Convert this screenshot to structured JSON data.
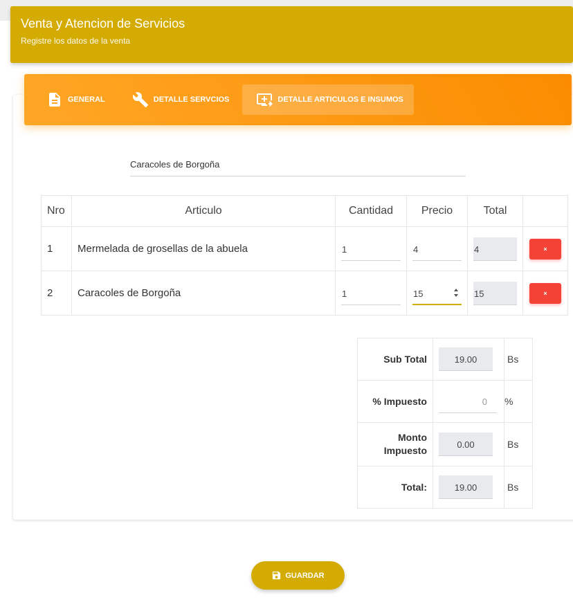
{
  "header": {
    "title": "Venta y Atencion de Servicios",
    "subtitle": "Registre los datos de la venta"
  },
  "tabs": [
    {
      "label": "GENERAL",
      "icon": "document-icon",
      "active": false
    },
    {
      "label": "DETALLE SERVCIOS",
      "icon": "wrench-icon",
      "active": false
    },
    {
      "label": "DETALLE ARTICULOS E INSUMOS",
      "icon": "monitor-add-icon",
      "active": true
    }
  ],
  "product_select": {
    "value": "Caracoles de Borgoña"
  },
  "items_table": {
    "headers": [
      "Nro",
      "Articulo",
      "Cantidad",
      "Precio",
      "Total"
    ],
    "rows": [
      {
        "nro": "1",
        "articulo": "Mermelada de grosellas de la abuela",
        "cantidad": "1",
        "precio": "4",
        "total": "4",
        "delete": "×"
      },
      {
        "nro": "2",
        "articulo": "Caracoles de Borgoña",
        "cantidad": "1",
        "precio": "15",
        "total": "15",
        "delete": "×"
      }
    ]
  },
  "totals": {
    "subtotal": {
      "label": "Sub Total",
      "value": "19.00",
      "unit": "Bs"
    },
    "impuesto": {
      "label": "% Impuesto",
      "value": "0",
      "unit": "%"
    },
    "monto": {
      "label1": "Monto",
      "label2": "Impuesto",
      "value": "0.00",
      "unit": "Bs"
    },
    "total": {
      "label": "Total:",
      "value": "19.00",
      "unit": "Bs"
    }
  },
  "actions": {
    "save_label": "GUARDAR"
  },
  "colors": {
    "primary": "#d4ab00",
    "tabs": "#fb8c00",
    "danger": "#f44336"
  }
}
